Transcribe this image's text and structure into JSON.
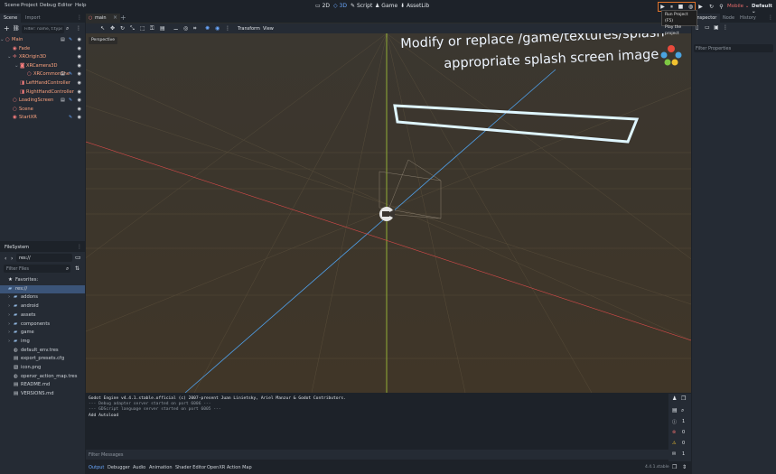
{
  "menubar": {
    "menus": [
      "Scene",
      "Project",
      "Debug",
      "Editor",
      "Help"
    ],
    "modes": [
      "2D",
      "3D",
      "Script",
      "Game",
      "AssetLib"
    ],
    "active_mode": "3D",
    "renderer": "Mobile",
    "layout": "Default"
  },
  "tooltip": {
    "line1": "Run Project (F5)",
    "line2": "Play the project"
  },
  "scene_panel": {
    "tabs": [
      "Scene",
      "Import"
    ],
    "filter_placeholder": "Filter: name, t:type, g:group",
    "nodes": [
      {
        "label": "Main",
        "depth": 0,
        "icon": "node3d-icon",
        "color": "#fc7f7f"
      },
      {
        "label": "Fade",
        "depth": 1,
        "icon": "node-icon",
        "color": "#fc7f7f"
      },
      {
        "label": "XROrigin3D",
        "depth": 1,
        "icon": "xr-origin-icon",
        "color": "#fc7f7f"
      },
      {
        "label": "XRCamera3D",
        "depth": 2,
        "icon": "camera-icon",
        "color": "#fc7f7f"
      },
      {
        "label": "XRCommonShe",
        "depth": 3,
        "icon": "node3d-icon",
        "color": "#fc7f7f"
      },
      {
        "label": "LeftHandController",
        "depth": 2,
        "icon": "controller-icon",
        "color": "#fc7f7f"
      },
      {
        "label": "RightHandController",
        "depth": 2,
        "icon": "controller-icon",
        "color": "#fc7f7f"
      },
      {
        "label": "LoadingScreen",
        "depth": 1,
        "icon": "node3d-icon",
        "color": "#fc7f7f"
      },
      {
        "label": "Scene",
        "depth": 1,
        "icon": "node3d-icon",
        "color": "#fc7f7f"
      },
      {
        "label": "StartXR",
        "depth": 1,
        "icon": "node-icon",
        "color": "#fc7f7f"
      }
    ]
  },
  "filesystem": {
    "title": "FileSystem",
    "path": "res://",
    "filter_placeholder": "Filter Files",
    "items": [
      {
        "label": "Favorites:",
        "icon": "star-icon",
        "depth": 0
      },
      {
        "label": "res://",
        "icon": "folder-icon",
        "depth": 0,
        "selected": true
      },
      {
        "label": "addons",
        "icon": "folder-icon",
        "depth": 1
      },
      {
        "label": "android",
        "icon": "folder-icon",
        "depth": 1
      },
      {
        "label": "assets",
        "icon": "folder-icon",
        "depth": 1
      },
      {
        "label": "components",
        "icon": "folder-icon",
        "depth": 1
      },
      {
        "label": "game",
        "icon": "folder-icon",
        "depth": 1
      },
      {
        "label": "img",
        "icon": "folder-icon",
        "depth": 1
      },
      {
        "label": "default_env.tres",
        "icon": "resource-icon",
        "depth": 1
      },
      {
        "label": "export_presets.cfg",
        "icon": "file-icon",
        "depth": 1
      },
      {
        "label": "icon.png",
        "icon": "image-icon",
        "depth": 1
      },
      {
        "label": "openxr_action_map.tres",
        "icon": "resource-icon",
        "depth": 1
      },
      {
        "label": "README.md",
        "icon": "file-icon",
        "depth": 1
      },
      {
        "label": "VERSIONS.md",
        "icon": "file-icon",
        "depth": 1
      }
    ]
  },
  "editor_tabs": {
    "open": [
      "main"
    ]
  },
  "viewport": {
    "toolbar_menus": [
      "Transform",
      "View"
    ],
    "perspective_label": "Perspective",
    "splash_line1": "Modify or replace /game/textures/splash",
    "splash_line2": "appropriate splash screen image"
  },
  "output": {
    "lines": [
      "Godot Engine v4.4.1.stable.official (c) 2007-present Juan Linietsky, Ariel Manzur & Godot Contributors.",
      "--- Debug adapter server started on port 6006 ---",
      "--- GDScript language server started on port 6005 ---",
      "Add Autoload"
    ],
    "filter_placeholder": "Filter Messages",
    "tabs": [
      "Output",
      "Debugger",
      "Audio",
      "Animation",
      "Shader Editor",
      "OpenXR Action Map"
    ],
    "version": "4.4.1.stable",
    "counts": {
      "info": "1",
      "error": "0",
      "warning": "0",
      "message": "1"
    }
  },
  "inspector": {
    "tabs": [
      "Inspector",
      "Node",
      "History"
    ],
    "filter_placeholder": "Filter Properties"
  },
  "colors": {
    "accent": "#6aa8ff",
    "node_red": "#fc7f7f",
    "highlight_orange": "#e0732a",
    "axis_green": "#a8cc3a",
    "axis_red": "#d94a4a",
    "axis_blue": "#4f9fe8"
  }
}
